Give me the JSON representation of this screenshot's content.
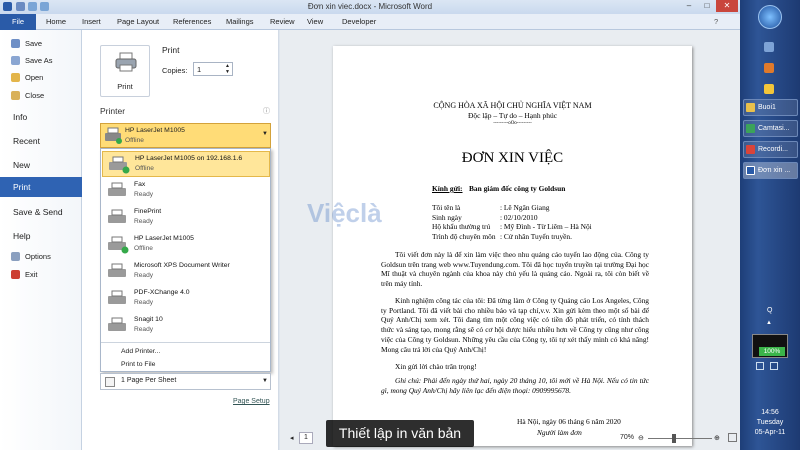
{
  "window": {
    "title": "Đơn xin viec.docx - Microsoft Word"
  },
  "ribbon": {
    "tabs": [
      "File",
      "Home",
      "Insert",
      "Page Layout",
      "References",
      "Mailings",
      "Review",
      "View",
      "Developer"
    ]
  },
  "backstage": {
    "items": [
      "Save",
      "Save As",
      "Open",
      "Close",
      "Info",
      "Recent",
      "New",
      "Print",
      "Save & Send",
      "Help",
      "Options",
      "Exit"
    ]
  },
  "print": {
    "heading": "Print",
    "button": "Print",
    "copies_label": "Copies:",
    "copies_value": "1",
    "printer_heading": "Printer",
    "selected_printer": "HP LaserJet M1005",
    "selected_status": "Offline",
    "pages_per_sheet": "1 Page Per Sheet",
    "page_setup": "Page Setup"
  },
  "printers": [
    {
      "name": "HP LaserJet M1005 on 192.168.1.6",
      "status": "Offline"
    },
    {
      "name": "Fax",
      "status": "Ready"
    },
    {
      "name": "FinePrint",
      "status": "Ready"
    },
    {
      "name": "HP LaserJet M1005",
      "status": "Offline"
    },
    {
      "name": "Microsoft XPS Document Writer",
      "status": "Ready"
    },
    {
      "name": "PDF-XChange 4.0",
      "status": "Ready"
    },
    {
      "name": "Snagit 10",
      "status": "Ready"
    }
  ],
  "dropdown_actions": {
    "add": "Add Printer...",
    "file": "Print to File"
  },
  "preview": {
    "page_value": "1",
    "page_of": "of 1",
    "zoom": "70%"
  },
  "document": {
    "header1": "CỘNG HÒA XÃ HỘI CHỦ NGHĨA VIỆT NAM",
    "header2": "Độc lập – Tự do – Hạnh phúc",
    "header3": "---------oOo---------",
    "title": "ĐƠN XIN VIỆC",
    "to_label": "Kính gửi:",
    "to_value": "Ban giám đốc công ty Goldsun",
    "fields": [
      {
        "k": "Tôi tên là",
        "v": ": Lê Ngân Giang"
      },
      {
        "k": "Sinh ngày",
        "v": ": 02/10/2010"
      },
      {
        "k": "Hộ khẩu thường trú",
        "v": ": Mỹ Đình - Từ Liêm – Hà Nội"
      },
      {
        "k": "Trình độ chuyên môn",
        "v": ": Cử nhân Tuyển truyền."
      }
    ],
    "p1": "Tôi viết đơn này là để xin làm việc theo nhu quảng cáo tuyển lao động của. Công ty Goldsun trên trang web www.Tuyendung.com. Tôi đã học tuyển truyền tại trường Đại học Mĩ thuật và chuyên ngành của khoa này chủ yếu là quảng cáo. Ngoài ra, tôi còn biết về trên máy tính.",
    "p2": "Kinh nghiệm công tác của tôi: Đã từng làm ở Công ty Quảng cáo Los Angeles, Công ty Portland. Tôi đã viết bài cho nhiều báo và tạp chí,v.v. Xin gửi kèm theo một số bài để Quý Anh/Chị xem xét. Tôi đang tìm một công việc có tiền đồ phát triển, có tính thách thức và sáng tạo, mong rằng sẽ có cơ hội được hiểu nhiều hơn về Công ty cũng như công việc của Công ty Goldsun. Những yêu cầu của Công ty, tôi tự xét thấy mình có khả năng! Mong câu trả lời của Quý Anh/Chị!",
    "p3": "Xin gửi lời chào trân trọng!",
    "p4": "Ghi chú: Phải đến ngày thứ hai, ngày 20 tháng 10, tôi mới về Hà Nội. Nếu có tin tức gì, mong Quý Anh/Chị hãy liên lạc đến điện thoại: 0909995678.",
    "date": "Hà Nội, ngày 06 tháng 6 năm 2020",
    "signer": "Người làm đơn"
  },
  "watermark": "Việclà",
  "subtitle": "Thiết lập in văn bản",
  "taskbar": {
    "items": [
      "Buoi1",
      "Camtasi...",
      "Recordi...",
      "Đơn xin ..."
    ],
    "battery": "100%",
    "time": "14:56",
    "day": "Tuesday",
    "date": "05-Apr-11",
    "q": "Q"
  },
  "colors": {
    "accent": "#2f63b3",
    "selected_printer_bg": "#ffe69a",
    "taskbar": "#2e5596"
  }
}
